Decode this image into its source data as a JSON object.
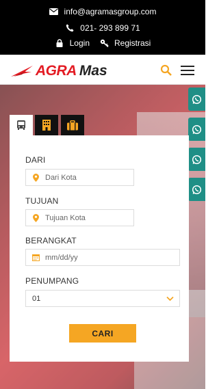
{
  "topbar": {
    "email": "info@agramasgroup.com",
    "phone": "021- 293 899 71",
    "login_label": "Login",
    "register_label": "Registrasi"
  },
  "header": {
    "logo_primary": "AGRA",
    "logo_secondary": "Mas",
    "menu_icon": "hamburger-icon",
    "search_icon": "search-icon"
  },
  "tabs": [
    {
      "icon": "bus-icon",
      "active": true
    },
    {
      "icon": "hotel-icon",
      "active": false
    },
    {
      "icon": "luggage-icon",
      "active": false
    }
  ],
  "form": {
    "from_label": "DARI",
    "from_placeholder": "Dari Kota",
    "to_label": "TUJUAN",
    "to_placeholder": "Tujuan Kota",
    "depart_label": "BERANGKAT",
    "depart_placeholder": "mm/dd/yy",
    "passenger_label": "PENUMPANG",
    "passenger_value": "01",
    "submit_label": "CARI"
  },
  "side_buttons": [
    "whatsapp-icon",
    "whatsapp-icon",
    "whatsapp-icon",
    "whatsapp-icon"
  ],
  "colors": {
    "accent": "#f5a623",
    "brand_red": "#e31b23",
    "whatsapp": "#1f8f86"
  }
}
